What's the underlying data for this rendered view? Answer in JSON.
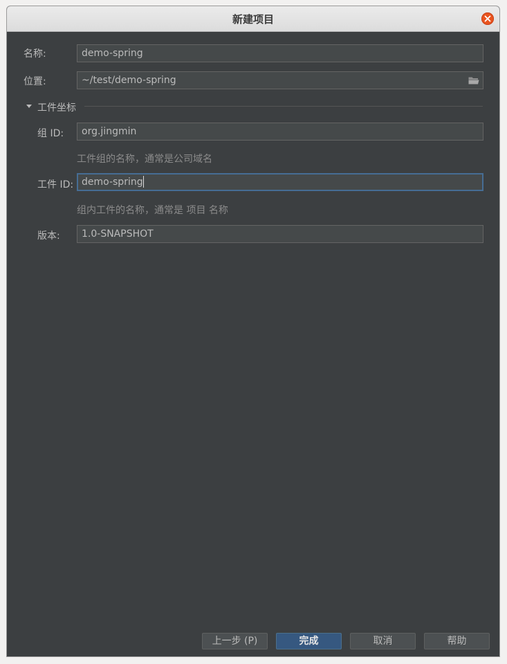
{
  "window": {
    "title": "新建项目"
  },
  "form": {
    "name": {
      "label": "名称:",
      "value": "demo-spring"
    },
    "location": {
      "label": "位置:",
      "value": "~/test/demo-spring"
    }
  },
  "artifact_section": {
    "label": "工件坐标",
    "group_id": {
      "label": "组 ID:",
      "value": "org.jingmin",
      "hint": "工件组的名称，通常是公司域名"
    },
    "artifact_id": {
      "label": "工件 ID:",
      "value": "demo-spring",
      "hint": "组内工件的名称，通常是 项目 名称"
    },
    "version": {
      "label": "版本:",
      "value": "1.0-SNAPSHOT"
    }
  },
  "buttons": {
    "previous": "上一步 (P)",
    "finish": "完成",
    "cancel": "取消",
    "help": "帮助"
  },
  "colors": {
    "background": "#3c3f41",
    "field_background": "#45494a",
    "focus_border": "#466d94",
    "primary_button": "#365880",
    "close_button": "#e9541f"
  }
}
